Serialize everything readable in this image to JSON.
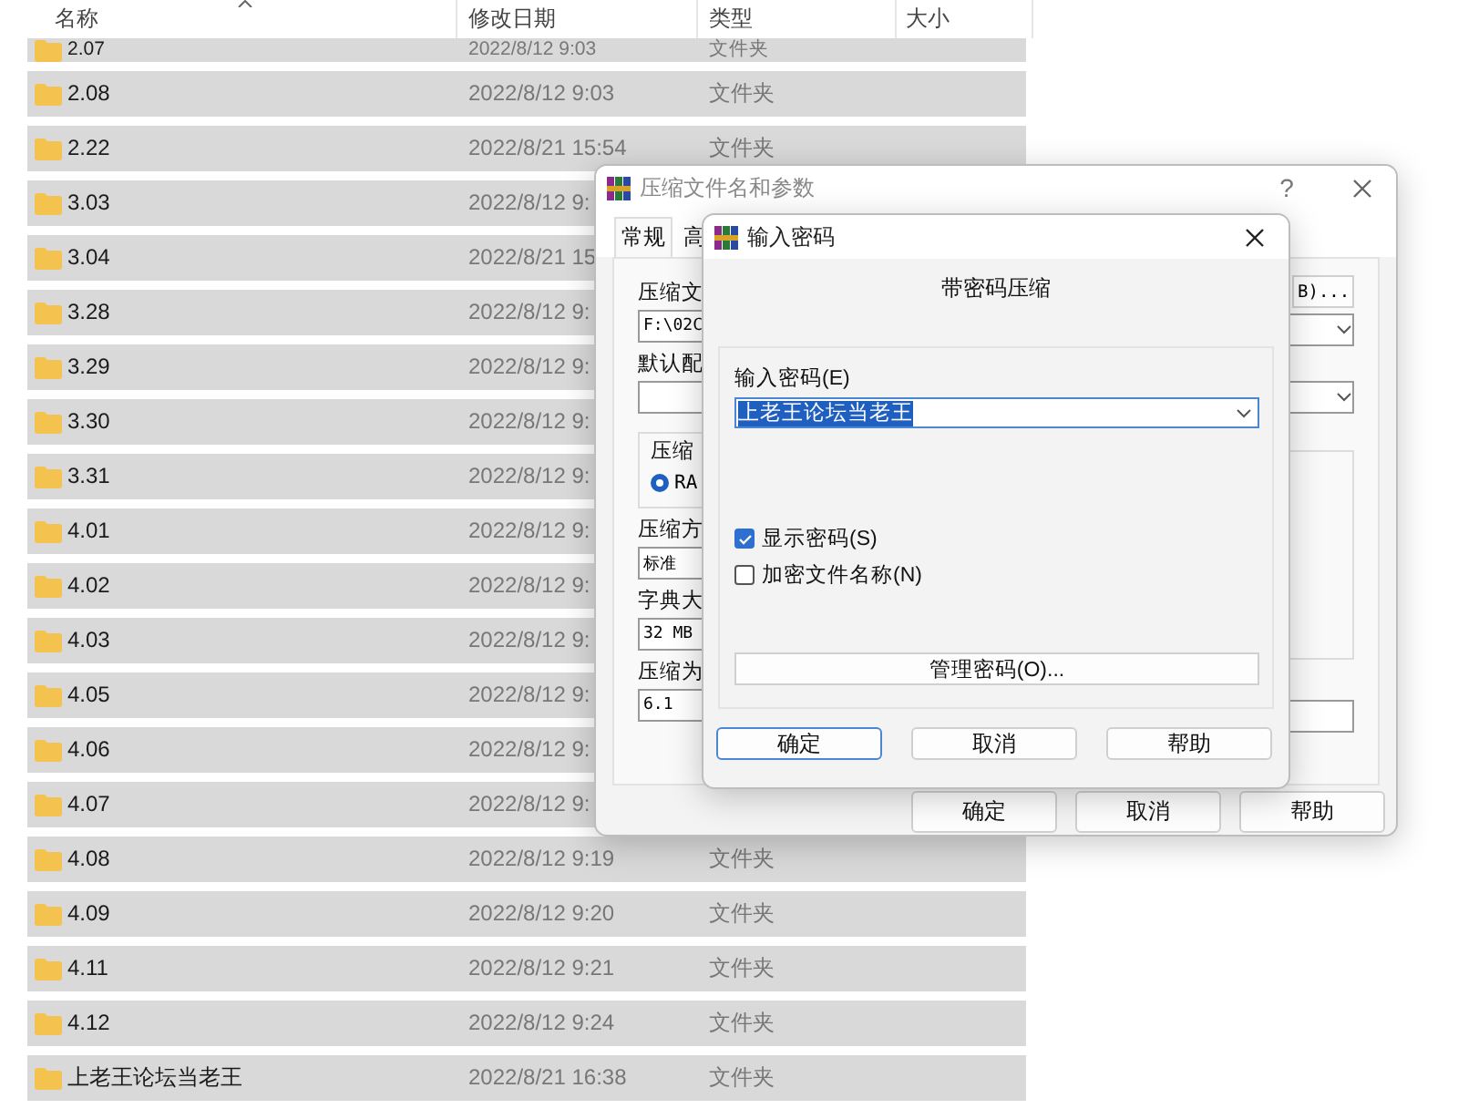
{
  "file_list": {
    "columns": [
      "名称",
      "修改日期",
      "类型",
      "大小"
    ],
    "rows": [
      {
        "name": "2.07",
        "date": "2022/8/12 9:03",
        "type": "文件夹"
      },
      {
        "name": "2.08",
        "date": "2022/8/12 9:03",
        "type": "文件夹"
      },
      {
        "name": "2.22",
        "date": "2022/8/21 15:54",
        "type": "文件夹"
      },
      {
        "name": "3.03",
        "date": "2022/8/12 9:"
      },
      {
        "name": "3.04",
        "date": "2022/8/21 15"
      },
      {
        "name": "3.28",
        "date": "2022/8/12 9:"
      },
      {
        "name": "3.29",
        "date": "2022/8/12 9:"
      },
      {
        "name": "3.30",
        "date": "2022/8/12 9:"
      },
      {
        "name": "3.31",
        "date": "2022/8/12 9:"
      },
      {
        "name": "4.01",
        "date": "2022/8/12 9:"
      },
      {
        "name": "4.02",
        "date": "2022/8/12 9:"
      },
      {
        "name": "4.03",
        "date": "2022/8/12 9:"
      },
      {
        "name": "4.05",
        "date": "2022/8/12 9:"
      },
      {
        "name": "4.06",
        "date": "2022/8/12 9:"
      },
      {
        "name": "4.07",
        "date": "2022/8/12 9:"
      },
      {
        "name": "4.08",
        "date": "2022/8/12 9:19",
        "type": "文件夹"
      },
      {
        "name": "4.09",
        "date": "2022/8/12 9:20",
        "type": "文件夹"
      },
      {
        "name": "4.11",
        "date": "2022/8/12 9:21",
        "type": "文件夹"
      },
      {
        "name": "4.12",
        "date": "2022/8/12 9:24",
        "type": "文件夹"
      },
      {
        "name": "上老王论坛当老王",
        "date": "2022/8/21 16:38",
        "type": "文件夹"
      }
    ]
  },
  "compress_dialog": {
    "title": "压缩文件名和参数",
    "help": "?",
    "tabs": [
      {
        "label": "常规",
        "selected": true
      },
      {
        "label": "高",
        "selected": false
      }
    ],
    "left_items": [
      {
        "kind": "label",
        "text": "压缩文"
      },
      {
        "kind": "field",
        "text": "F:\\02C"
      },
      {
        "kind": "label",
        "text": "默认配"
      },
      {
        "kind": "field"
      },
      {
        "kind": "group",
        "text": "压缩",
        "radio": {
          "label": "RA",
          "selected": true
        }
      },
      {
        "kind": "label",
        "text": "压缩方"
      },
      {
        "kind": "field",
        "text": "标准"
      },
      {
        "kind": "label",
        "text": "字典大"
      },
      {
        "kind": "field",
        "text": "32 MB"
      },
      {
        "kind": "label",
        "text": "压缩为"
      },
      {
        "kind": "field",
        "text": "6.1"
      }
    ],
    "right_items": [
      {
        "kind": "button",
        "text": "B)..."
      },
      {
        "kind": "dropdown"
      },
      {
        "kind": "dropdown"
      },
      {
        "kind": "group"
      },
      {
        "kind": "field"
      }
    ],
    "buttons": [
      "确定",
      "取消",
      "帮助"
    ]
  },
  "password_dialog": {
    "title": "输入密码",
    "heading": "带密码压缩",
    "field_label": "输入密码(E)",
    "password": "上老王论坛当老王",
    "options": [
      {
        "label": "显示密码(S)",
        "checked": true
      },
      {
        "label": "加密文件名称(N)",
        "checked": false
      }
    ],
    "manage_button": "管理密码(O)...",
    "buttons": [
      {
        "label": "确定",
        "default": true
      },
      {
        "label": "取消",
        "default": false
      },
      {
        "label": "帮助",
        "default": false
      }
    ]
  }
}
